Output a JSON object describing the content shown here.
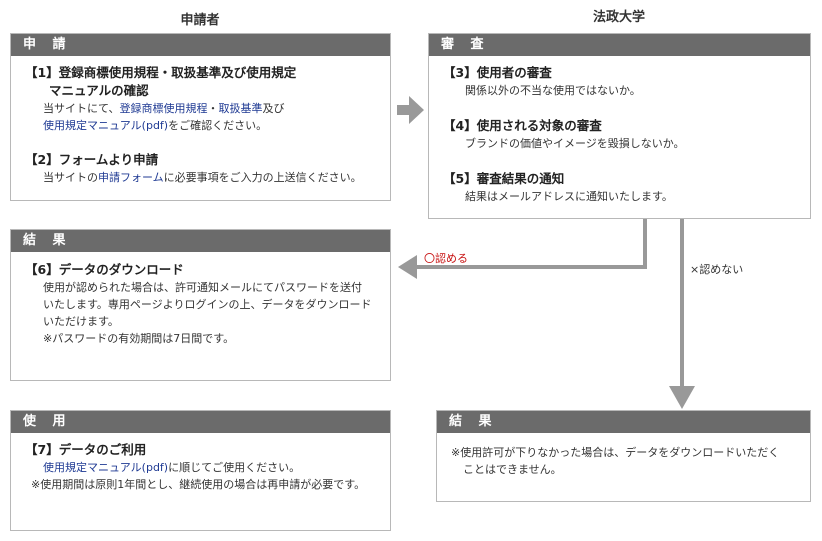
{
  "columns": {
    "applicant": "申請者",
    "university": "法政大学"
  },
  "apply": {
    "header": "申 請",
    "step1": {
      "title_a": "【1】登録商標使用規程・取扱基準及び使用規定",
      "title_b": "マニュアルの確認",
      "l1_pre": "当サイトにて、",
      "l1_link1": "登録商標使用規程",
      "l1_sep": "・",
      "l1_link2": "取扱基準",
      "l1_post": "及び",
      "l2_link": "使用規定マニュアル(pdf)",
      "l2_post": "をご確認ください。"
    },
    "step2": {
      "title": "【2】フォームより申請",
      "l1_pre": "当サイトの",
      "l1_link": "申請フォーム",
      "l1_post": "に必要事項をご入力の上送信ください。"
    }
  },
  "review": {
    "header": "審 査",
    "step3": {
      "title": "【3】使用者の審査",
      "desc": "関係以外の不当な使用ではないか。"
    },
    "step4": {
      "title": "【4】使用される対象の審査",
      "desc": "ブランドの価値やイメージを毀損しないか。"
    },
    "step5": {
      "title": "【5】審査結果の通知",
      "desc": "結果はメールアドレスに通知いたします。"
    }
  },
  "result_left": {
    "header": "結 果",
    "step6": {
      "title": "【6】データのダウンロード",
      "l1": "使用が認められた場合は、許可通知メールにてパスワードを送付",
      "l2": "いたします。専用ページよりログインの上、データをダウンロード",
      "l3": "いただけます。",
      "l4": "※パスワードの有効期間は7日間です。"
    }
  },
  "usage": {
    "header": "使 用",
    "step7": {
      "title": "【7】データのご利用",
      "l1_link": "使用規定マニュアル(pdf)",
      "l1_post": "に順じてご使用ください。",
      "l2": "※使用期間は原則1年間とし、継続使用の場合は再申請が必要です。"
    }
  },
  "result_right": {
    "header": "結 果",
    "l1": "※使用許可が下りなかった場合は、データをダウンロードいただく",
    "l2": "ことはできません。"
  },
  "arrows": {
    "approved": "〇認める",
    "rejected": "×認めない"
  },
  "colors": {
    "bar": "#6b6b6b",
    "arrow": "#999999",
    "link": "#1f3a93",
    "approved": "#c81414"
  }
}
